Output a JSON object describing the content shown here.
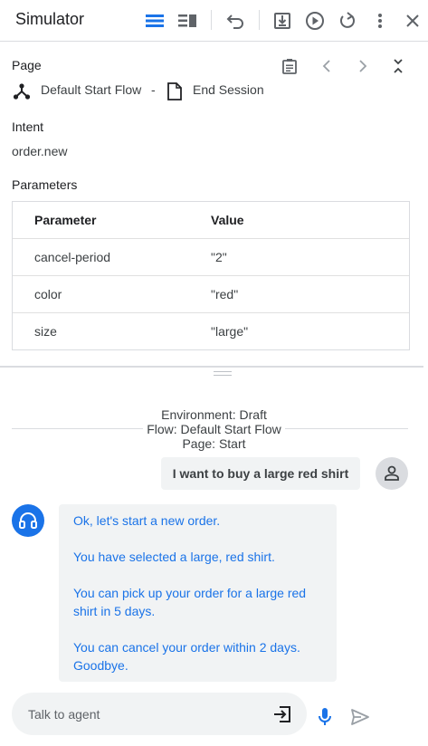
{
  "header": {
    "title": "Simulator",
    "icons": [
      "list-view-icon",
      "split-view-icon",
      "undo-icon",
      "download-icon",
      "play-icon",
      "reset-icon",
      "more-vert-icon",
      "close-icon"
    ],
    "accent": "#1a73e8"
  },
  "page_section": {
    "label": "Page",
    "flow_name": "Default Start Flow",
    "separator": "-",
    "page_name": "End Session"
  },
  "intent_section": {
    "label": "Intent",
    "value": "order.new"
  },
  "parameters_section": {
    "label": "Parameters",
    "columns": [
      "Parameter",
      "Value"
    ],
    "rows": [
      {
        "name": "cancel-period",
        "value": "\"2\""
      },
      {
        "name": "color",
        "value": "\"red\""
      },
      {
        "name": "size",
        "value": "\"large\""
      }
    ]
  },
  "environment": {
    "environment": "Environment: Draft",
    "flow": "Flow: Default Start Flow",
    "page": "Page: Start"
  },
  "chat": {
    "user_message": "I want to buy a large red shirt",
    "agent_lines": [
      "Ok, let's start a new order.",
      "You have selected a large, red shirt.",
      "You can pick up your order for a large red",
      "shirt in 5 days.",
      "You can cancel your order within 2 days.",
      "Goodbye."
    ]
  },
  "input": {
    "placeholder": "Talk to agent",
    "value": ""
  }
}
